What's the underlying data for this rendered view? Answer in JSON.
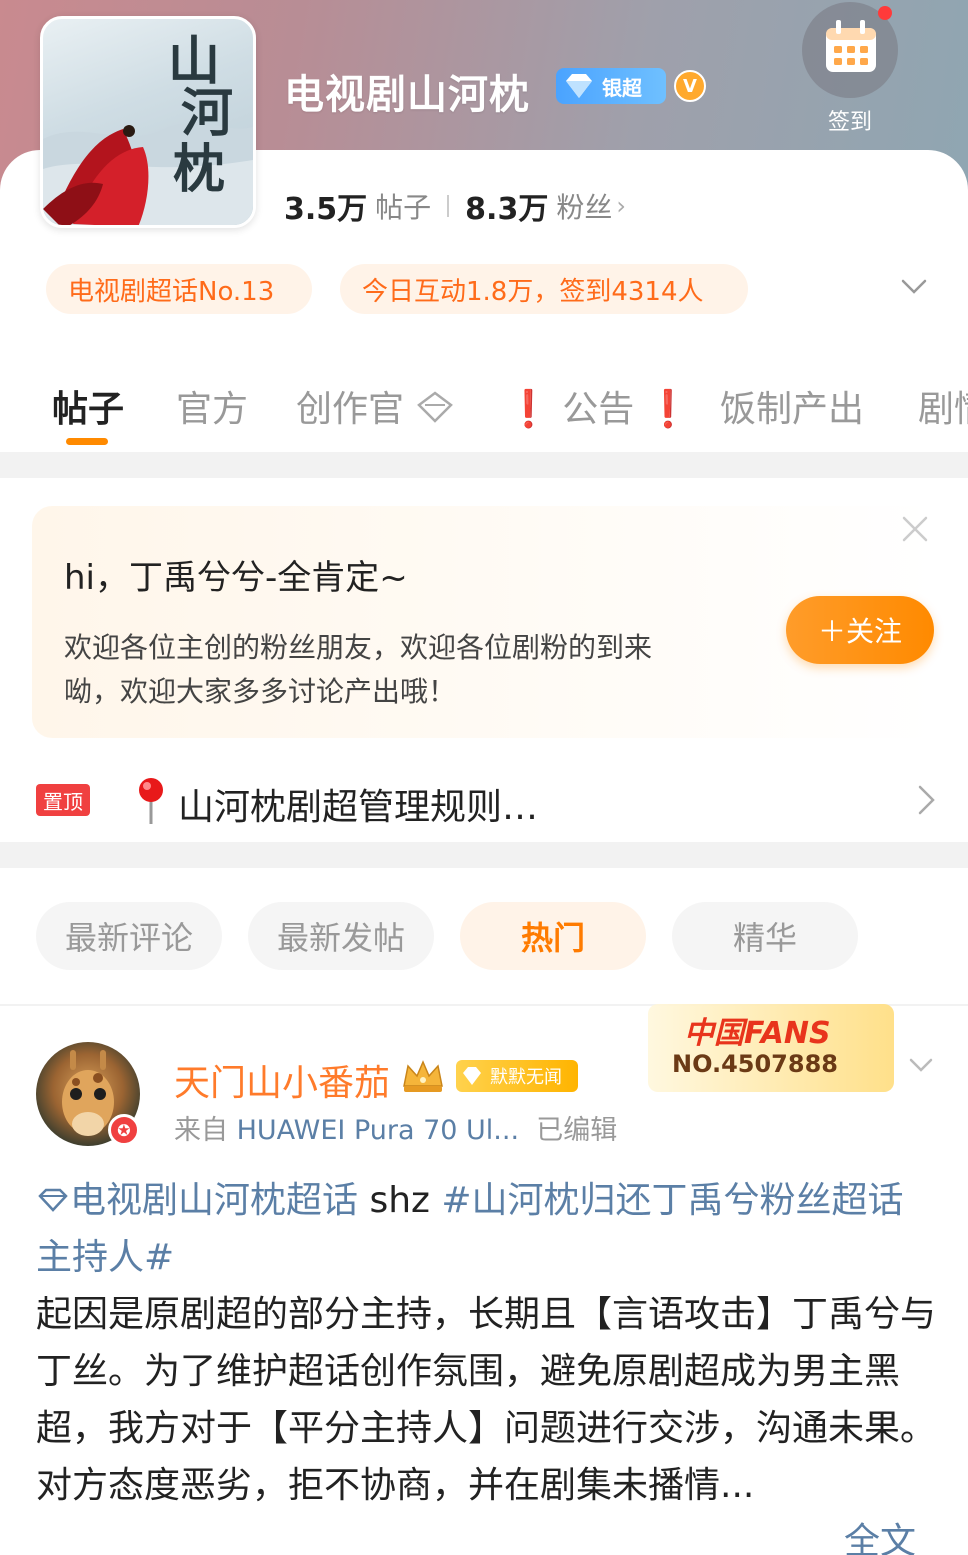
{
  "header": {
    "title": "电视剧山河枕",
    "rank_badge": "银超",
    "verified_mark": "V",
    "checkin_label": "签到",
    "cover_text": "山河枕"
  },
  "stats": {
    "posts_value": "3.5万",
    "posts_label": "帖子",
    "fans_value": "8.3万",
    "fans_label": "粉丝",
    "fans_chevron": "›"
  },
  "pills": {
    "rank": "电视剧超话No.13",
    "today": "今日互动1.8万，签到4314人"
  },
  "tabs": [
    {
      "label": "帖子"
    },
    {
      "label": "官方"
    },
    {
      "label": "创作官"
    },
    {
      "label": "公告"
    },
    {
      "label": "饭制产出"
    },
    {
      "label": "剧情"
    }
  ],
  "exclamation": "❗",
  "welcome": {
    "greeting": "hi，丁禹兮兮-全肯定~",
    "text": "欢迎各位主创的粉丝朋友，欢迎各位剧粉的到来呦，欢迎大家多多讨论产出哦！",
    "follow_button": "＋关注"
  },
  "pinned": {
    "tag": "置顶",
    "title": "山河枕剧超管理规则…"
  },
  "filters": [
    {
      "label": "最新评论"
    },
    {
      "label": "最新发帖"
    },
    {
      "label": "热门",
      "active": true
    },
    {
      "label": "精华"
    }
  ],
  "post": {
    "username": "天门山小番茄",
    "user_tag": "默默无闻",
    "source_prefix": "来自 ",
    "source_device": "HUAWEI Pura 70 Ul...",
    "edited": "已编辑",
    "fans_banner_title": "中国FANS",
    "fans_banner_no": "NO.4507888",
    "topic_super": "电视剧山河枕超话",
    "plain_shz": " shz ",
    "topic_hashtag": "#山河枕归还丁禹兮粉丝超话主持人#",
    "body_1": "起因是原剧超的部分主持，长期且【言语攻击】丁禹兮与丁丝。为了维护超话创作氛围，避免原剧超成为男主黑超，我方对于【平分主持人】问题进行交涉，沟通未果。",
    "body_2": "对方态度恶劣，拒不协商，并在剧集未播情...",
    "more_link": "全文"
  },
  "colors": {
    "accent": "#ff8a00",
    "link": "#5b7fa6",
    "pill_bg": "#fff3e8",
    "pill_text": "#ff6b1a"
  }
}
